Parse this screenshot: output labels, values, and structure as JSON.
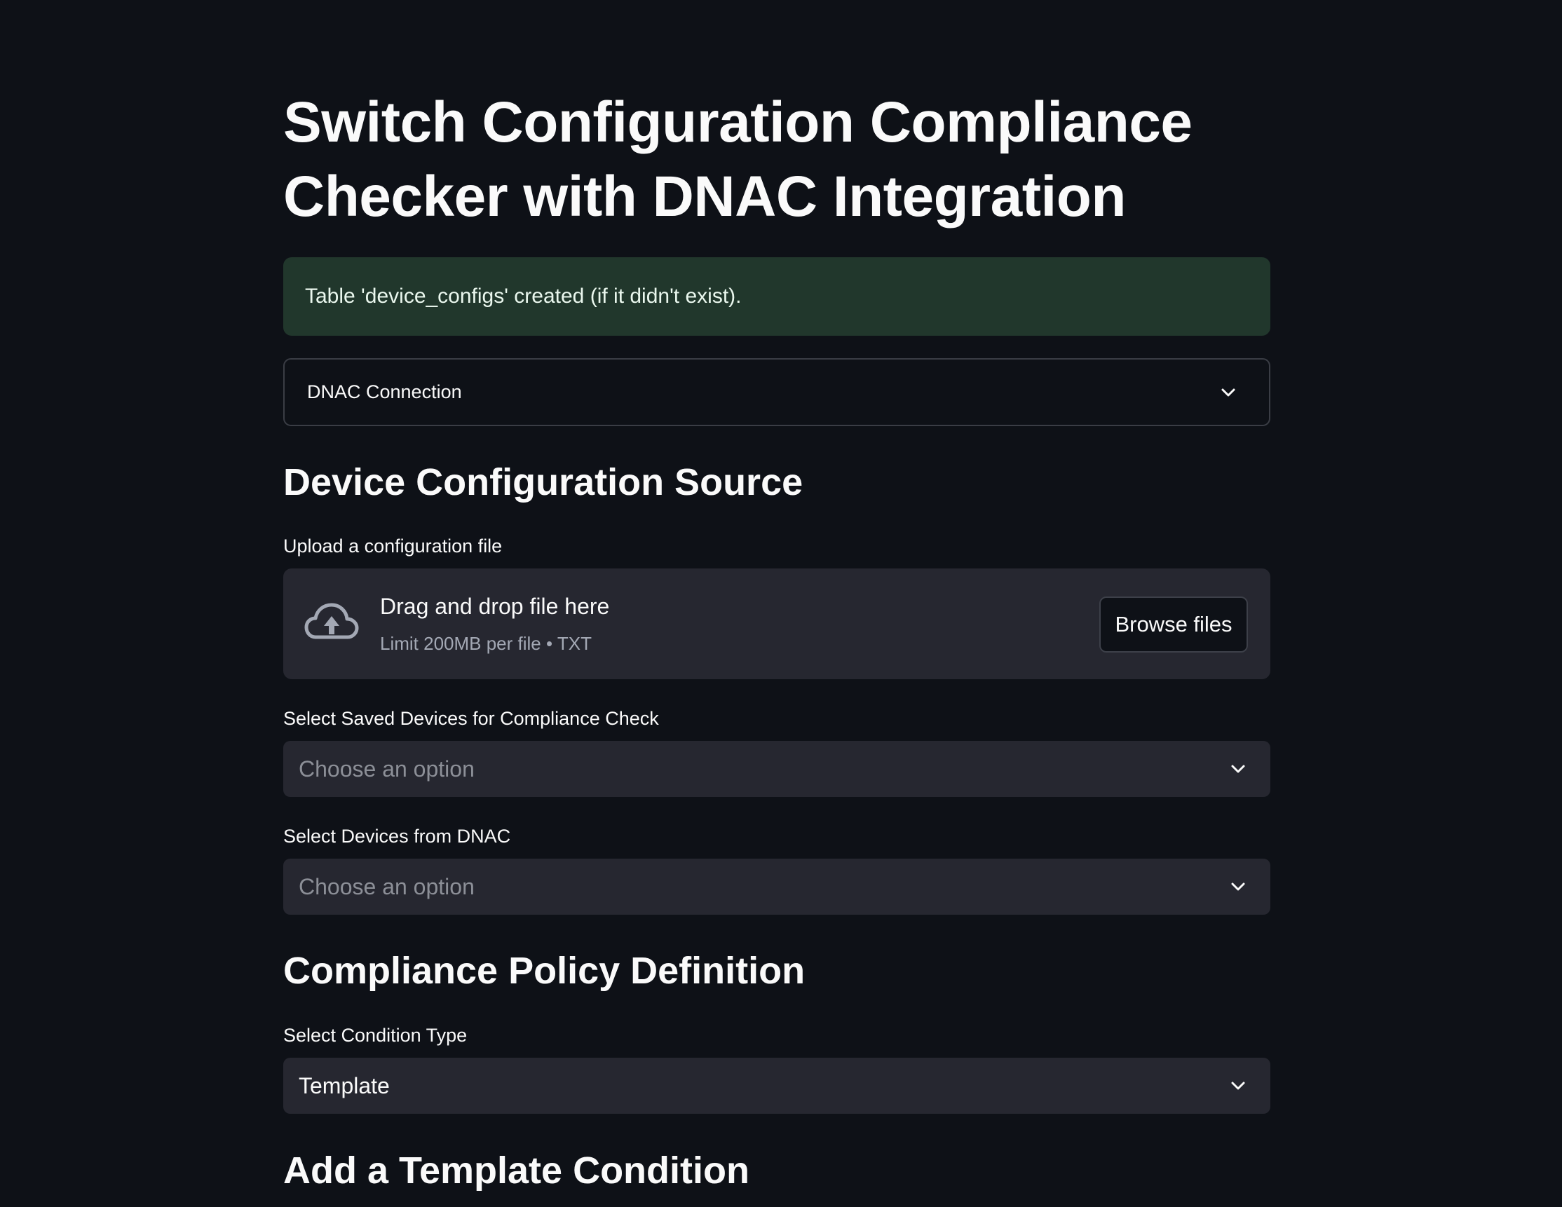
{
  "title": "Switch Configuration Compliance Checker with DNAC Integration",
  "alert": {
    "text": "Table 'device_configs' created (if it didn't exist)."
  },
  "expander": {
    "label": "DNAC Connection",
    "icon": "chevron-down-icon"
  },
  "source_section": {
    "heading": "Device Configuration Source",
    "upload": {
      "label": "Upload a configuration file",
      "drop_text": "Drag and drop file here",
      "limit_text": "Limit 200MB per file • TXT",
      "browse_label": "Browse files",
      "icon": "cloud-upload-icon"
    },
    "saved_devices": {
      "label": "Select Saved Devices for Compliance Check",
      "placeholder": "Choose an option"
    },
    "dnac_devices": {
      "label": "Select Devices from DNAC",
      "placeholder": "Choose an option"
    }
  },
  "policy_section": {
    "heading": "Compliance Policy Definition",
    "condition_type": {
      "label": "Select Condition Type",
      "value": "Template"
    }
  },
  "template_section": {
    "heading": "Add a Template Condition"
  },
  "colors": {
    "background": "#0e1117",
    "alert_background": "#21372c",
    "input_background": "#262730",
    "border": "#3a3d45",
    "text": "#fafafa",
    "muted_text": "#8c8f97"
  }
}
